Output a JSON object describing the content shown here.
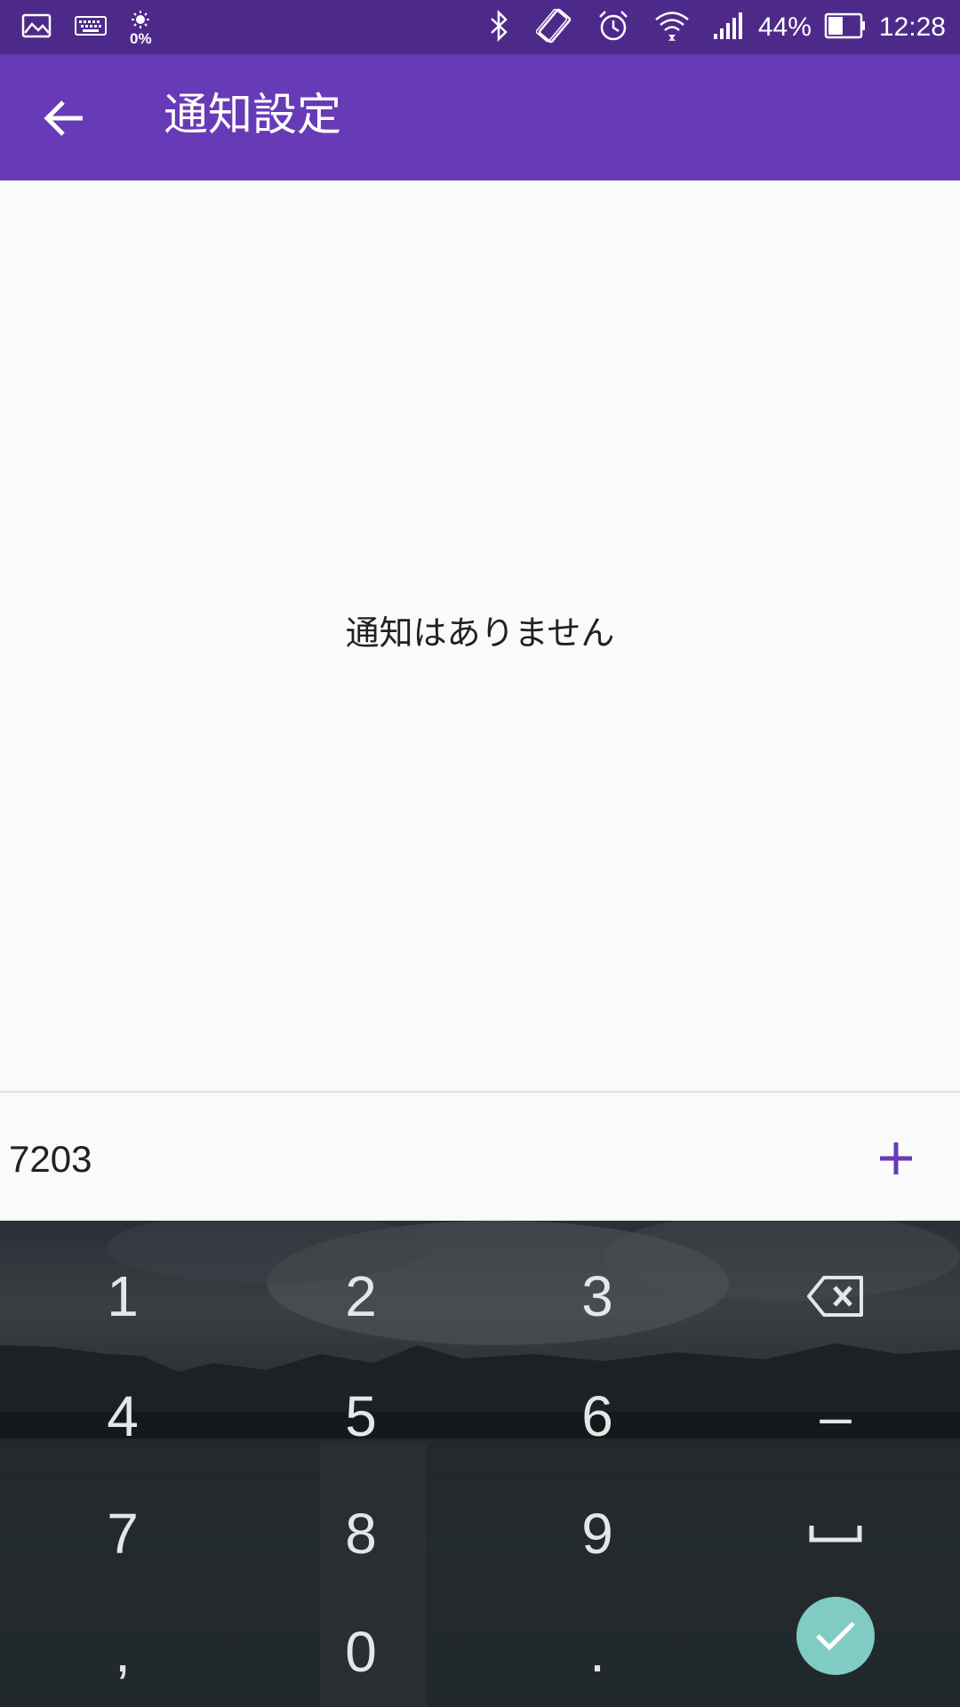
{
  "status_bar": {
    "brightness": "0%",
    "battery": "44%",
    "time": "12:28",
    "left_icons": [
      "image-icon",
      "keyboard-icon",
      "brightness-icon"
    ],
    "right_icons": [
      "bluetooth-icon",
      "auto-rotate-icon",
      "alarm-icon",
      "wifi-icon",
      "signal-icon",
      "battery-icon"
    ]
  },
  "app_bar": {
    "title": "通知設定",
    "back_icon": "arrow-left-icon"
  },
  "content": {
    "empty_message": "通知はありません"
  },
  "input": {
    "value": "7203",
    "add_icon": "plus-icon",
    "accent_color": "#673ab7"
  },
  "keyboard": {
    "keys": [
      "1",
      "2",
      "3",
      "4",
      "5",
      "6",
      "7",
      "8",
      "9",
      ",",
      "0",
      "."
    ],
    "backspace_icon": "backspace-icon",
    "minus_key": "–",
    "space_icon": "space-icon",
    "done_icon": "check-icon",
    "done_color": "#80cbc4"
  },
  "colors": {
    "status_bar": "#4d2a8a",
    "app_bar": "#673ab7",
    "background": "#fafafa"
  }
}
